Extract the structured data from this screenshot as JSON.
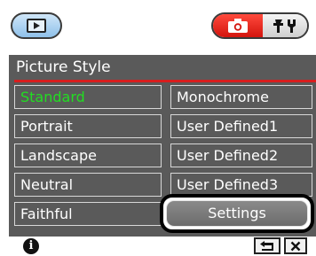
{
  "panel": {
    "title": "Picture Style",
    "left_column": [
      {
        "label": "Standard",
        "selected": true
      },
      {
        "label": "Portrait",
        "selected": false
      },
      {
        "label": "Landscape",
        "selected": false
      },
      {
        "label": "Neutral",
        "selected": false
      },
      {
        "label": "Faithful",
        "selected": false
      }
    ],
    "right_column": [
      {
        "label": "Monochrome"
      },
      {
        "label": "User Defined1"
      },
      {
        "label": "User Defined2"
      },
      {
        "label": "User Defined3"
      }
    ],
    "settings_label": "Settings"
  },
  "icons": {
    "playback": "playback-icon",
    "camera": "camera-icon",
    "tools": "tools-icon",
    "info": "info-icon",
    "back": "back-icon",
    "close": "close-icon"
  },
  "colors": {
    "panel_bg": "#5a5a5a",
    "selected_text": "#22dd22",
    "accent_red": "#d81e1e",
    "camera_tab": "#e0241a",
    "playback_btn": "#a9d2f0"
  },
  "bottom": {
    "info_glyph": "i"
  }
}
